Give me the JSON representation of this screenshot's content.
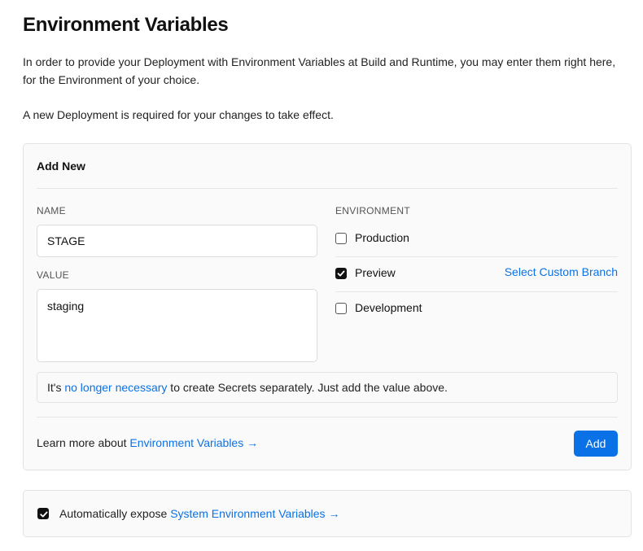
{
  "title": "Environment Variables",
  "intro": "In order to provide your Deployment with Environment Variables at Build and Runtime, you may enter them right here, for the Environment of your choice.",
  "note": "A new Deployment is required for your changes to take effect.",
  "add_new": {
    "title": "Add New",
    "name_label": "NAME",
    "name_value": "STAGE",
    "value_label": "VALUE",
    "value_value": "staging",
    "environment_label": "ENVIRONMENT",
    "environments": [
      {
        "label": "Production",
        "checked": false
      },
      {
        "label": "Preview",
        "checked": true
      },
      {
        "label": "Development",
        "checked": false
      }
    ],
    "custom_branch_link": "Select Custom Branch",
    "info_prefix": "It's ",
    "info_link": "no longer necessary",
    "info_suffix": " to create Secrets separately. Just add the value above.",
    "learn_prefix": "Learn more about ",
    "learn_link": "Environment Variables →",
    "add_button": "Add"
  },
  "system": {
    "checked": true,
    "prefix": "Automatically expose ",
    "link": "System Environment Variables →"
  },
  "colors": {
    "accent": "#0a72e6",
    "card_bg": "#fafafa",
    "border": "#e3e3e3"
  }
}
